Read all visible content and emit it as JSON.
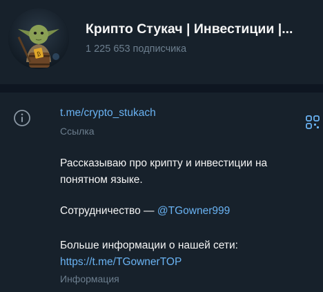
{
  "channel": {
    "title": "Крипто Стукач | Инвестиции |...",
    "subscribers": "1 225 653 подписчика"
  },
  "info": {
    "link": "t.me/crypto_stukach",
    "link_caption": "Ссылка",
    "description_line1": "Рассказываю про крипту и инвестиции на",
    "description_line2": "понятном языке.",
    "cooperation_label": "Сотрудничество —",
    "cooperation_contact": "@TGowner999",
    "more_info_label": "Больше информации о нашей сети:",
    "more_info_url": "https://t.me/TGownerTOP",
    "info_caption": "Информация"
  },
  "icons": {
    "info": "info-circle-icon",
    "qr": "qr-code-icon"
  },
  "colors": {
    "background": "#17212b",
    "separator": "#0e1621",
    "link": "#6ab3f3",
    "secondary_text": "#6d7f8f"
  }
}
